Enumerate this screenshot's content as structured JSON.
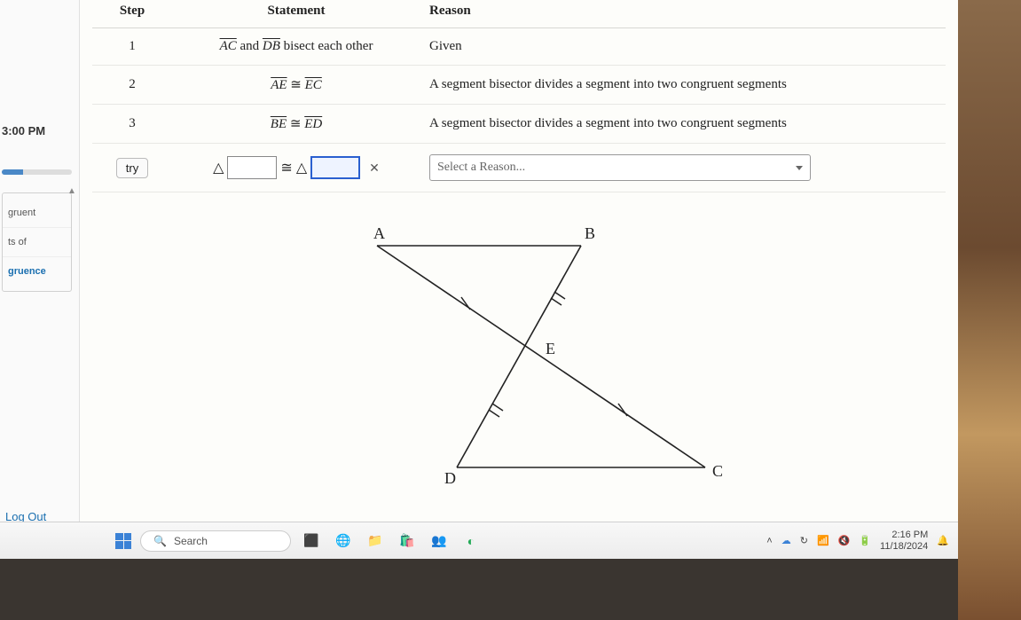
{
  "sidebar": {
    "due_label": "3:00 PM",
    "items": [
      "gruent",
      "ts of",
      "gruence"
    ],
    "logout": "Log Out"
  },
  "headers": {
    "step": "Step",
    "statement": "Statement",
    "reason": "Reason"
  },
  "rows": [
    {
      "step": "1",
      "stmt_pre": "AC",
      "stmt_mid": " and ",
      "stmt_post": "DB",
      "stmt_tail": " bisect each other",
      "reason": "Given"
    },
    {
      "step": "2",
      "seg_a": "AE",
      "seg_b": "EC",
      "reason": "A segment bisector divides a segment into two congruent segments"
    },
    {
      "step": "3",
      "seg_a": "BE",
      "seg_b": "ED",
      "reason": "A segment bisector divides a segment into two congruent segments"
    }
  ],
  "input_row": {
    "try_label": "try",
    "reason_placeholder": "Select a Reason..."
  },
  "diagram": {
    "labels": {
      "A": "A",
      "B": "B",
      "C": "C",
      "D": "D",
      "E": "E"
    }
  },
  "taskbar": {
    "search_placeholder": "Search",
    "time": "2:16 PM",
    "date": "11/18/2024"
  }
}
